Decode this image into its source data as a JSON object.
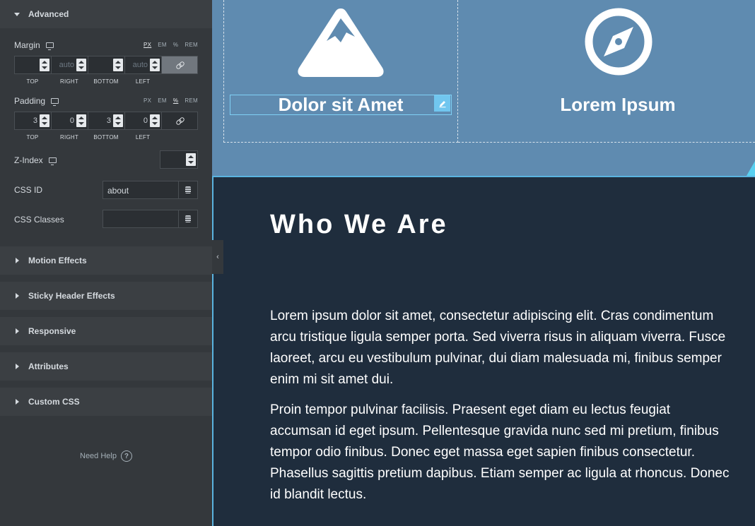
{
  "panel": {
    "advanced_label": "Advanced",
    "margin": {
      "label": "Margin",
      "units": [
        "PX",
        "EM",
        "%",
        "REM"
      ],
      "active_unit": "PX",
      "values": [
        "",
        "auto",
        "",
        "auto"
      ],
      "sides": [
        "TOP",
        "RIGHT",
        "BOTTOM",
        "LEFT"
      ],
      "linked": true
    },
    "padding": {
      "label": "Padding",
      "units": [
        "PX",
        "EM",
        "%",
        "REM"
      ],
      "active_unit": "%",
      "values": [
        "3",
        "0",
        "3",
        "0"
      ],
      "sides": [
        "TOP",
        "RIGHT",
        "BOTTOM",
        "LEFT"
      ],
      "linked": false
    },
    "zindex": {
      "label": "Z-Index",
      "value": ""
    },
    "css_id": {
      "label": "CSS ID",
      "value": "about"
    },
    "css_classes": {
      "label": "CSS Classes",
      "value": ""
    },
    "sections": [
      "Motion Effects",
      "Sticky Header Effects",
      "Responsive",
      "Attributes",
      "Custom CSS"
    ],
    "need_help": "Need Help",
    "help_glyph": "?",
    "collapse_glyph": "‹"
  },
  "canvas": {
    "col1_heading": "Dolor sit Amet",
    "col2_heading": "Lorem Ipsum",
    "about_title": "Who We Are",
    "para1": "Lorem ipsum dolor sit amet, consectetur adipiscing elit. Cras condimentum arcu tristique ligula semper porta. Sed viverra risus in aliquam viverra. Fusce laoreet, arcu eu vestibulum pulvinar, dui diam malesuada mi, finibus semper enim mi sit amet dui.",
    "para2": "Proin tempor pulvinar facilisis. Praesent eget diam eu lectus feugiat accumsan id eget ipsum. Pellentesque gravida nunc sed mi pretium, finibus tempor odio finibus. Donec eget massa eget sapien finibus consectetur. Phasellus sagittis pretium dapibus. Etiam semper ac ligula at rhoncus. Donec id blandit lectus.",
    "icons": [
      "mountain-icon",
      "compass-icon"
    ],
    "colors": {
      "top_bg": "#5f8bb0",
      "about_bg": "#1f2d3d",
      "accent": "#5ab4e0"
    }
  }
}
